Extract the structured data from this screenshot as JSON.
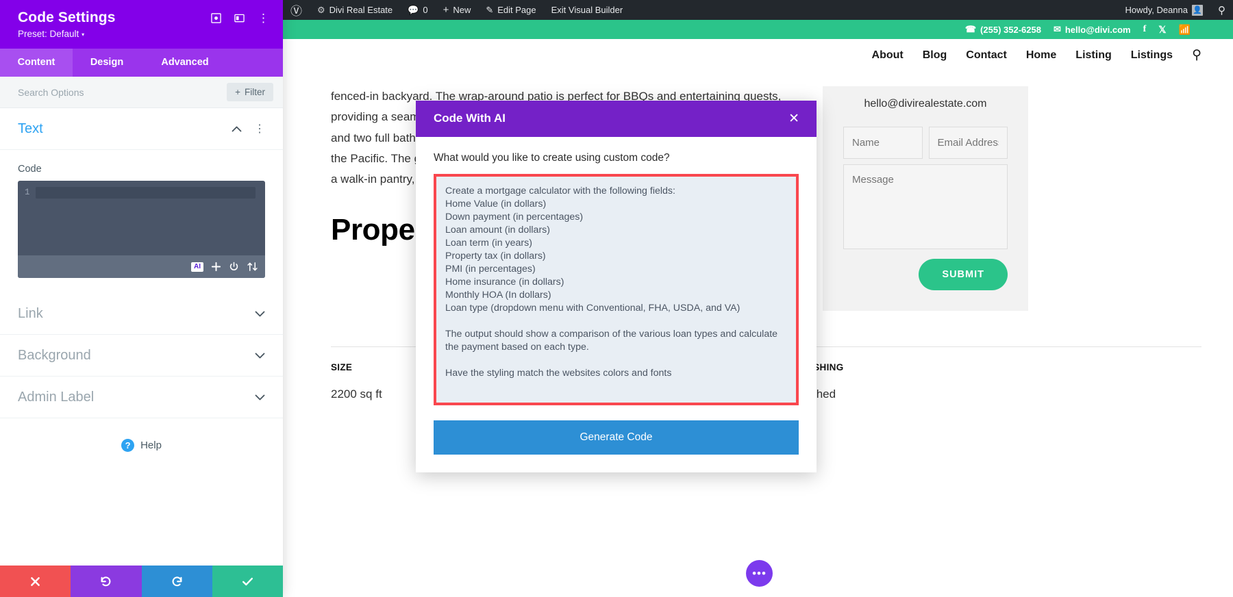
{
  "settings_panel": {
    "title": "Code Settings",
    "preset": "Preset: Default",
    "preset_caret": "▾",
    "icons": [
      {
        "name": "focus-icon",
        "glyph": "⬚"
      },
      {
        "name": "layout-icon",
        "glyph": "▤"
      },
      {
        "name": "kebab-menu-icon",
        "glyph": "⋮"
      }
    ],
    "tabs": [
      {
        "label": "Content",
        "active": true
      },
      {
        "label": "Design",
        "active": false
      },
      {
        "label": "Advanced",
        "active": false
      }
    ],
    "search": {
      "placeholder": "Search Options",
      "value": ""
    },
    "filter_label": "Filter",
    "filter_plus": "+",
    "sections": [
      {
        "label": "Text",
        "open": true
      },
      {
        "label": "Link",
        "open": false
      },
      {
        "label": "Background",
        "open": false
      },
      {
        "label": "Admin Label",
        "open": false
      }
    ],
    "code_field": {
      "label": "Code",
      "line_number": "1",
      "value": "",
      "toolbar": [
        {
          "name": "ai-button",
          "label": "AI"
        },
        {
          "name": "add-icon",
          "glyph": "+"
        },
        {
          "name": "power-icon",
          "glyph": "⏻"
        },
        {
          "name": "sort-icon",
          "glyph": "↕"
        }
      ]
    },
    "help_label": "Help",
    "help_glyph": "?",
    "footer_buttons": [
      {
        "name": "cancel-button",
        "glyph": "✖"
      },
      {
        "name": "undo-button",
        "glyph": "↺"
      },
      {
        "name": "redo-button",
        "glyph": "↻"
      },
      {
        "name": "save-button",
        "glyph": "✔"
      }
    ]
  },
  "adminbar": {
    "wp_logo_glyph": "Ⓦ",
    "site_icon_glyph": "⚙",
    "site_name": "Divi Real Estate",
    "comments_glyph": "⌨",
    "comments_count": "0",
    "new_glyph": "+",
    "new_label": "New",
    "edit_glyph": "✎",
    "edit_label": "Edit Page",
    "exit_label": "Exit Visual Builder",
    "howdy": "Howdy, Deanna",
    "avatar_glyph": "■",
    "search_glyph": "⌕"
  },
  "site": {
    "topbar": {
      "phone_icon": "☎",
      "phone": "(255) 352-6258",
      "email_icon": "✉",
      "email": "hello@divi.com",
      "social": [
        {
          "name": "facebook-icon",
          "glyph": "f"
        },
        {
          "name": "x-twitter-icon",
          "glyph": "✕"
        },
        {
          "name": "rss-icon",
          "glyph": "◔"
        }
      ]
    },
    "nav": {
      "items": [
        "About",
        "Blog",
        "Contact",
        "Home",
        "Listing",
        "Listings"
      ],
      "search_glyph": "⌕"
    },
    "article": {
      "paragraph": "fenced-in backyard. The wrap-around patio is perfect for BBQs and entertaining guests, providing a seamless indoor-outdoor flow. The home features three spacious bedrooms and two full bathrooms, with an open floor plan and large windows showcasing views of the Pacific. The gourmet kitchen is a delight for both cooks and guests, with a utility sink, a walk-in pantry, and room from the kitchen.",
      "title": "Property Details"
    },
    "specs": [
      {
        "label": "SIZE",
        "value": "2200 sq ft"
      },
      {
        "label": "FURNISHING",
        "value": "Furnished"
      }
    ],
    "contact_form": {
      "email": "hello@divirealestate.com",
      "name_placeholder": "Name",
      "email_placeholder": "Email Address",
      "message_placeholder": "Message",
      "submit_label": "SUBMIT"
    },
    "floating_button_glyph": "•••"
  },
  "modal": {
    "title": "Code With AI",
    "close_glyph": "✕",
    "question": "What would you like to create using custom code?",
    "prompt_value": "Create a mortgage calculator with the following fields:\nHome Value (in dollars)\nDown payment (in percentages)\nLoan amount (in dollars)\nLoan term (in years)\nProperty tax (in dollars)\nPMI (in percentages)\nHome insurance (in dollars)\nMonthly HOA (In dollars)\nLoan type (dropdown menu with Conventional, FHA, USDA, and VA)\n\nThe output should show a comparison of the various loan types and calculate the payment based on each type.\n\nHave the styling match the websites colors and fonts",
    "generate_label": "Generate Code"
  },
  "colors": {
    "divi_purple": "#8300e9",
    "modal_purple": "#7421c7",
    "green": "#2bc48a",
    "blue": "#2d8fd5",
    "red_outline": "#f9474e",
    "admin_dark": "#23282d"
  }
}
